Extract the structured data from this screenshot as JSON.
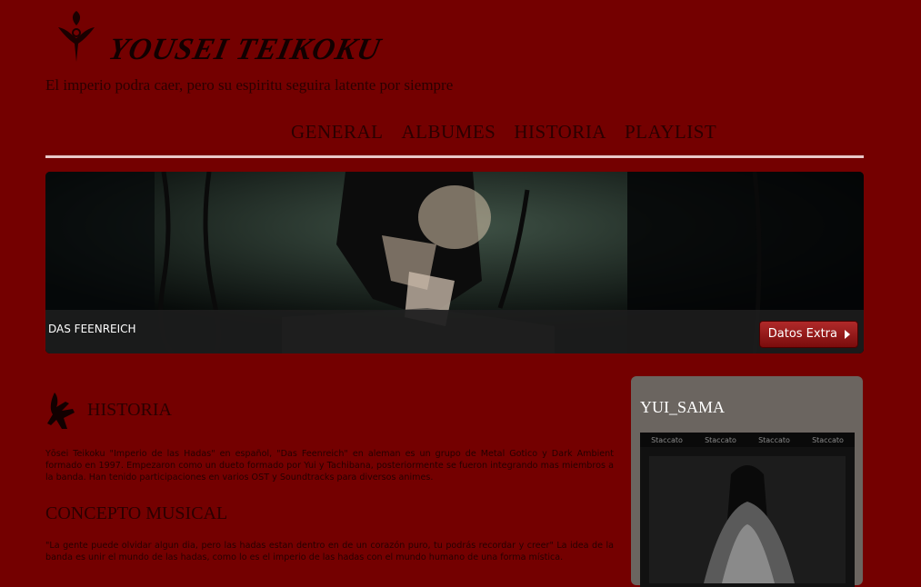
{
  "site": {
    "title": "YOUSEI TEIKOKU",
    "tagline": "El imperio podra caer, pero su espiritu seguira latente por siempre"
  },
  "nav": {
    "items": [
      {
        "label": "GENERAL"
      },
      {
        "label": "ALBUMES"
      },
      {
        "label": "HISTORIA"
      },
      {
        "label": "PLAYLIST"
      }
    ]
  },
  "banner": {
    "caption": "DAS FEENREICH",
    "button_label": "Datos Extra"
  },
  "main": {
    "section_title": "HISTORIA",
    "historia_text": "Yōsei Teikoku \"Imperio de las Hadas\" en español, \"Das Feenreich\" en aleman es un grupo de Metal Gotico y Dark Ambient formado en 1997. Empezaron como un dueto formado por Yui y Tachibana, posteriormente se fueron integrando mas miembros a la banda. Han tenido participaciones en varios OST y Soundtracks para diversos animes.",
    "concepto_title": "CONCEPTO MUSICAL",
    "concepto_text": "\"La gente puede olvidar algun dia, pero las hadas estan dentro en de un corazón puro, tu podrás recordar y creer\" La idea de la banda es unir el mundo de las hadas, como lo es el imperio de las hadas con el mundo humano de una forma mística."
  },
  "sidebar": {
    "title": "YUI_SAMA",
    "image_strip": [
      "Staccato",
      "Staccato",
      "Staccato",
      "Staccato"
    ]
  },
  "colors": {
    "background": "#740000",
    "text_dark": "#2a0000",
    "button_red": "#9a1a1a",
    "sidebar_grey": "#6b6560"
  }
}
